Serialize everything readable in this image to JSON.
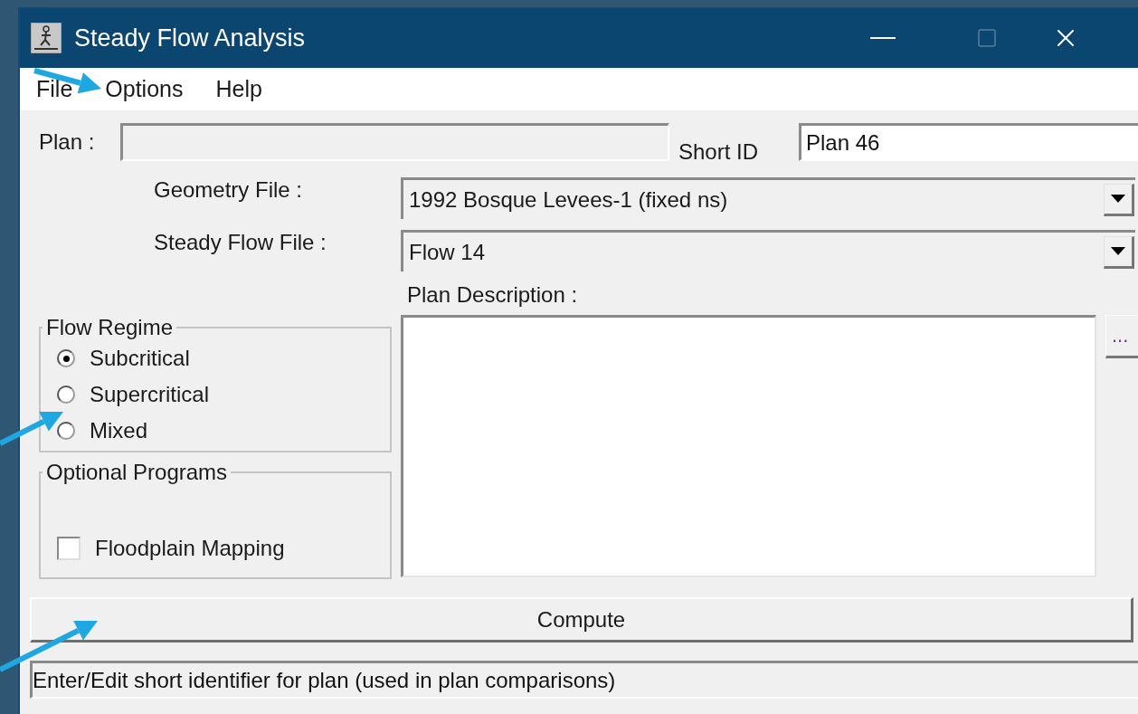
{
  "window": {
    "title": "Steady Flow Analysis"
  },
  "menu": [
    {
      "label": "File"
    },
    {
      "label": "Options"
    },
    {
      "label": "Help"
    }
  ],
  "plan": {
    "label": "Plan :"
  },
  "short_id": {
    "label": "Short ID",
    "value": "Plan 46"
  },
  "files": [
    {
      "label": "Geometry File :",
      "value": "1992 Bosque Levees-1 (fixed ns)"
    },
    {
      "label": "Steady Flow File :",
      "value": "Flow 14"
    }
  ],
  "flow_regime": {
    "title": "Flow Regime",
    "options": [
      {
        "label": "Subcritical",
        "selected": true
      },
      {
        "label": "Supercritical",
        "selected": false
      },
      {
        "label": "Mixed",
        "selected": false
      }
    ]
  },
  "optional_programs": {
    "title": "Optional Programs",
    "items": [
      {
        "label": "Floodplain Mapping",
        "checked": false
      }
    ]
  },
  "plan_description": {
    "label": "Plan Description :",
    "button": "..."
  },
  "compute_button": "Compute",
  "status_bar": "Enter/Edit short identifier for plan (used in plan comparisons)"
}
